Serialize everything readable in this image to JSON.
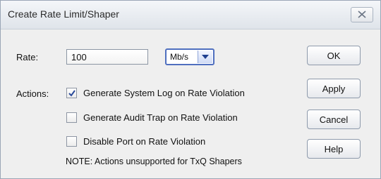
{
  "dialog": {
    "title": "Create Rate Limit/Shaper",
    "close_icon": "close-x-icon"
  },
  "rate": {
    "label": "Rate:",
    "value": "100",
    "unit": "Mb/s",
    "unit_arrow_icon": "chevron-down-icon"
  },
  "actions": {
    "label": "Actions:",
    "options": [
      {
        "label": "Generate System Log on Rate Violation",
        "checked": true
      },
      {
        "label": "Generate Audit Trap on Rate Violation",
        "checked": false
      },
      {
        "label": "Disable Port on Rate Violation",
        "checked": false
      }
    ],
    "note": "NOTE: Actions unsupported for TxQ Shapers"
  },
  "buttons": {
    "ok": "OK",
    "apply": "Apply",
    "cancel": "Cancel",
    "help": "Help"
  },
  "colors": {
    "accent": "#4f6fbf",
    "checkmark": "#2a4a9a"
  }
}
